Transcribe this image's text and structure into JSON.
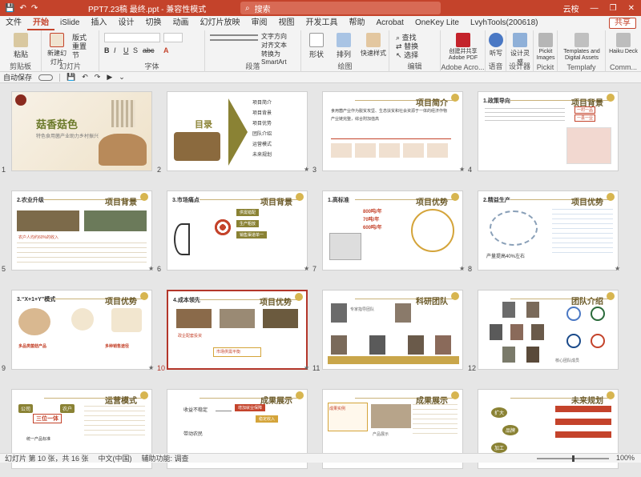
{
  "titlebar": {
    "autosave": "自动保存",
    "title": "PPT7.23稿 最终.ppt - 兼容性模式",
    "search_placeholder": "搜索",
    "user": "云桉",
    "minimize": "—",
    "restore": "❐",
    "close": "✕"
  },
  "menu": {
    "tabs": [
      "文件",
      "开始",
      "iSlide",
      "插入",
      "设计",
      "切换",
      "动画",
      "幻灯片放映",
      "审阅",
      "视图",
      "开发工具",
      "帮助",
      "Acrobat",
      "OneKey Lite",
      "LvyhTools(200618)"
    ],
    "share": "共享"
  },
  "ribbon": {
    "groups": [
      {
        "label": "剪贴板",
        "buttons": [
          "粘贴"
        ]
      },
      {
        "label": "幻灯片",
        "buttons": [
          "新建幻灯片",
          "版式",
          "重置",
          "节"
        ]
      },
      {
        "label": "字体",
        "buttons": [
          "B",
          "I",
          "U",
          "S",
          "abc",
          "A"
        ]
      },
      {
        "label": "段落",
        "buttons": [
          "文字方向",
          "对齐文本",
          "转换为SmartArt"
        ]
      },
      {
        "label": "绘图",
        "buttons": [
          "形状",
          "排列",
          "快速样式"
        ]
      },
      {
        "label": "编辑",
        "buttons": [
          "查找",
          "替换",
          "选择"
        ]
      },
      {
        "label": "Adobe Acro...",
        "buttons": [
          "创建并共享Adobe PDF"
        ]
      },
      {
        "label": "语音",
        "buttons": [
          "听写"
        ]
      },
      {
        "label": "设计器",
        "buttons": [
          "设计灵感"
        ]
      },
      {
        "label": "Pickit",
        "buttons": [
          "Pickit Images"
        ]
      },
      {
        "label": "Templafy",
        "buttons": [
          "Templates and Digital Assets"
        ]
      },
      {
        "label": "Comm...",
        "buttons": [
          "Haiku Deck"
        ]
      }
    ]
  },
  "slides": [
    {
      "num": "1",
      "title": "",
      "heading": "菇香菇色",
      "sub": "特色食用菌产业助力乡村振兴"
    },
    {
      "num": "2",
      "title": "目录",
      "items": [
        "项目简介",
        "项目背景",
        "项目优势",
        "团队介绍",
        "运营模式",
        "未来规划"
      ]
    },
    {
      "num": "3",
      "title": "项目简介",
      "items": [
        "食用菌产业作为脱贫攻坚、生态扶贫和社会资源于一体的经济作物",
        "产业链完整，综合附加值高"
      ]
    },
    {
      "num": "4",
      "title": "项目背景",
      "items": [
        "1.政策导向",
        "一村一品",
        "一县一业"
      ]
    },
    {
      "num": "5",
      "title": "项目背景",
      "items": [
        "2.农业升级",
        "农户人均约60%的收入"
      ]
    },
    {
      "num": "6",
      "title": "项目背景",
      "items": [
        "3.市场痛点",
        "供需错配",
        "生产粗放",
        "销售渠道单一"
      ]
    },
    {
      "num": "7",
      "title": "项目优势",
      "items": [
        "1.高标准",
        "800吨/年",
        "70吨/年",
        "600吨/年"
      ]
    },
    {
      "num": "8",
      "title": "项目优势",
      "items": [
        "2.精益生产",
        "产量提高40%左右"
      ]
    },
    {
      "num": "9",
      "title": "项目优势",
      "items": [
        "3.“X+1+Y”模式",
        "多品类菌菇产品",
        "多种销售途径"
      ]
    },
    {
      "num": "10",
      "title": "项目优势",
      "items": [
        "4.成本领先",
        "政企配套投资",
        "市场供需平衡"
      ]
    },
    {
      "num": "11",
      "title": "科研团队",
      "items": [
        "专家指导团队"
      ]
    },
    {
      "num": "12",
      "title": "团队介绍",
      "items": [
        "核心团队成员"
      ]
    },
    {
      "num": "13",
      "title": "运营模式",
      "items": [
        "公司",
        "三位一体",
        "农户",
        "统一产品标准"
      ]
    },
    {
      "num": "14",
      "title": "成果展示",
      "items": [
        "收益不稳定",
        "增加就业保障",
        "稳定收入",
        "带动农民"
      ]
    },
    {
      "num": "15",
      "title": "成果展示",
      "items": [
        "成果实例",
        "产品展示"
      ]
    },
    {
      "num": "16",
      "title": "未来规划",
      "items": [
        "扩大",
        "品牌",
        "加工"
      ]
    }
  ],
  "status": {
    "slide_info": "幻灯片 第 10 张，共 16 张",
    "language": "中文(中国)",
    "accessibility": "辅助功能: 调查",
    "zoom": "100%"
  },
  "colors": {
    "accent": "#c4432b",
    "gold": "#c9a64a",
    "olive": "#8a8234"
  }
}
